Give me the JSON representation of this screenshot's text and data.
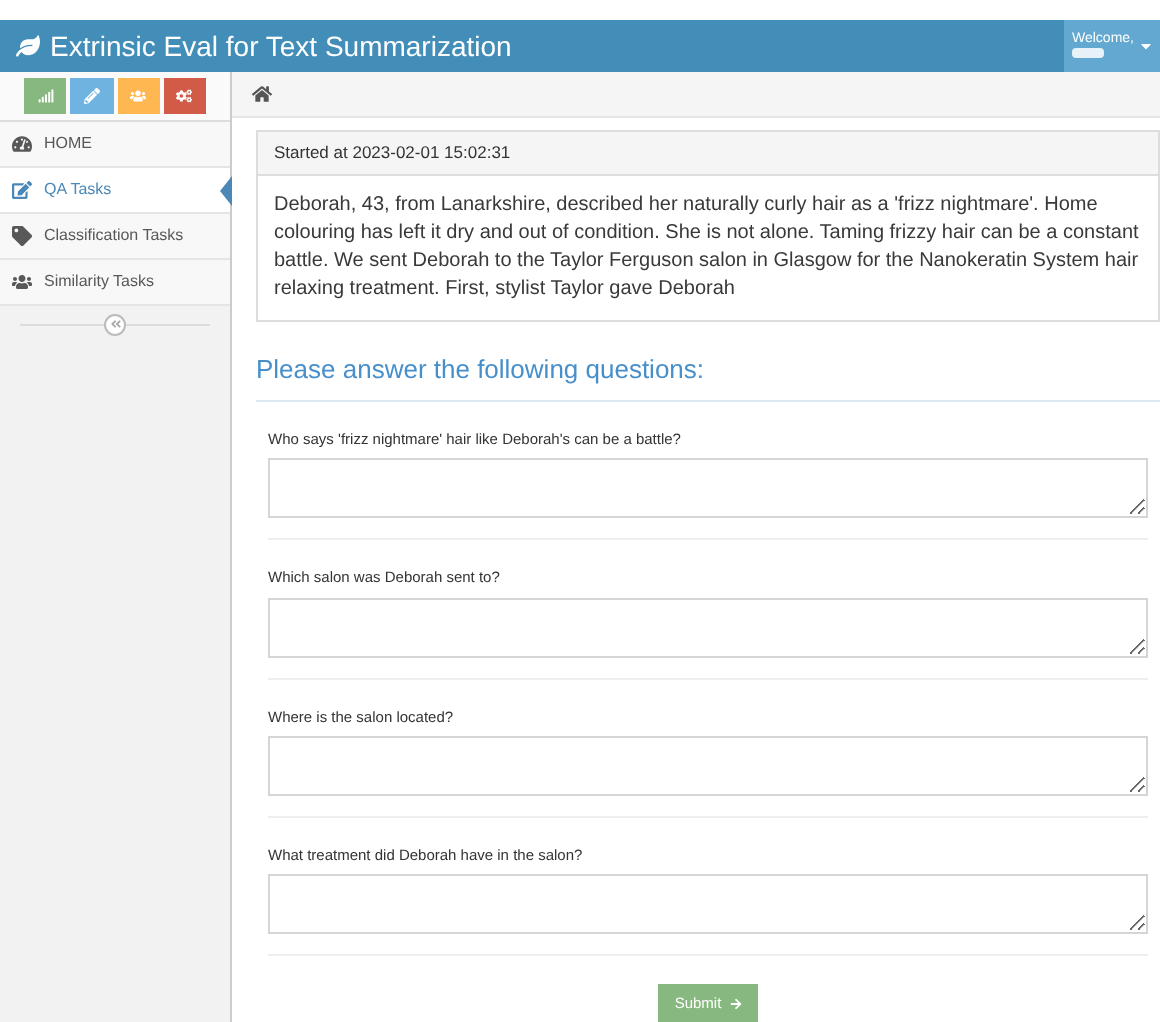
{
  "header": {
    "title": "Extrinsic Eval for Text Summarization",
    "user_greeting": "Welcome,"
  },
  "sidebar": {
    "shortcuts": [
      {
        "kind": "chart",
        "color": "#87b87f"
      },
      {
        "kind": "pencil",
        "color": "#6fb3e0"
      },
      {
        "kind": "users",
        "color": "#ffb752"
      },
      {
        "kind": "cogs",
        "color": "#d15b47"
      }
    ],
    "items": [
      {
        "label": "HOME",
        "selected": false
      },
      {
        "label": "QA Tasks",
        "selected": true
      },
      {
        "label": "Classification Tasks",
        "selected": false
      },
      {
        "label": "Similarity Tasks",
        "selected": false
      }
    ]
  },
  "panel": {
    "heading": "Started at 2023-02-01 15:02:31",
    "text": "Deborah, 43, from Lanarkshire, described her naturally curly hair as a 'frizz nightmare'. Home colouring has left it dry and out of condition. She is not alone. Taming frizzy hair can be a constant battle. We sent Deborah to the Taylor Ferguson salon in Glasgow for the Nanokeratin System hair relaxing treatment. First, stylist Taylor gave Deborah"
  },
  "form": {
    "heading": "Please answer the following questions:",
    "questions": [
      {
        "label": "Who says 'frizz nightmare' hair like Deborah's can be a battle?"
      },
      {
        "label": "Which salon was Deborah sent to?"
      },
      {
        "label": "Where is the salon located?"
      },
      {
        "label": "What treatment did Deborah have in the salon?"
      }
    ],
    "submit": "Submit"
  }
}
